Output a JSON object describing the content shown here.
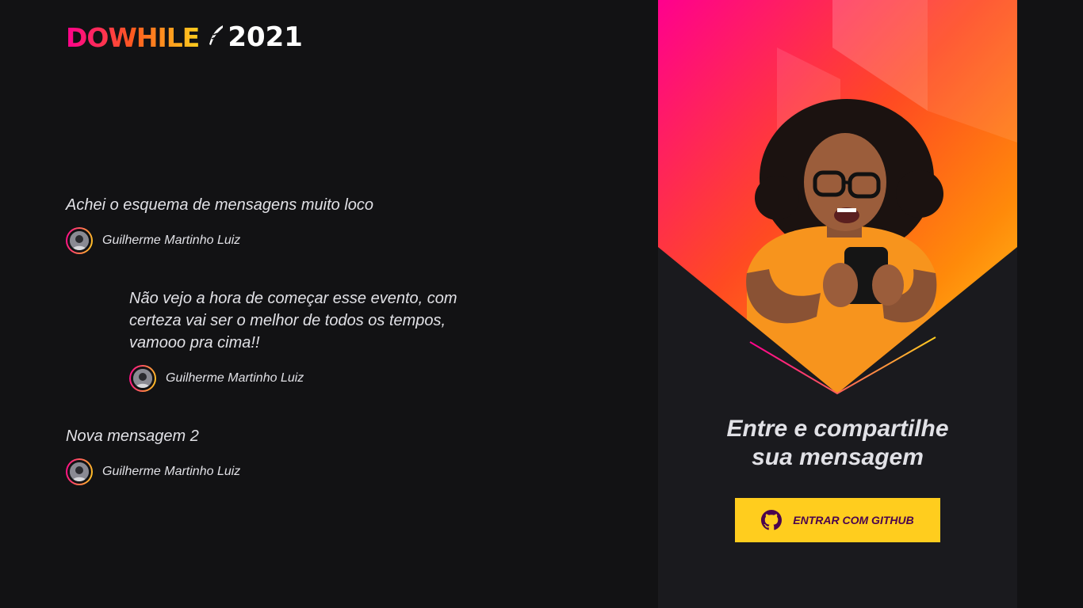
{
  "brand": {
    "logo_text": "DOWHILE",
    "logo_year": "2021",
    "colors": {
      "pink": "#ff008e",
      "orange": "#ff5a1f",
      "yellow": "#ffcd1e",
      "background": "#121214",
      "panel": "#1a1a1e"
    }
  },
  "messages": [
    {
      "text": "Achei o esquema de mensagens muito loco",
      "user": "Guilherme Martinho Luiz",
      "avatar_icon": "user-avatar"
    },
    {
      "text": "Não vejo a hora de começar esse evento, com certeza vai ser o melhor de todos os tempos, vamooo pra cima!!",
      "user": "Guilherme Martinho Luiz",
      "avatar_icon": "user-avatar"
    },
    {
      "text": "Nova mensagem 2",
      "user": "Guilherme Martinho Luiz",
      "avatar_icon": "user-avatar"
    }
  ],
  "login_box": {
    "title_line1": "Entre e compartilhe",
    "title_line2": "sua mensagem",
    "button_label": "ENTRAR COM GITHUB",
    "button_icon": "github-icon"
  }
}
